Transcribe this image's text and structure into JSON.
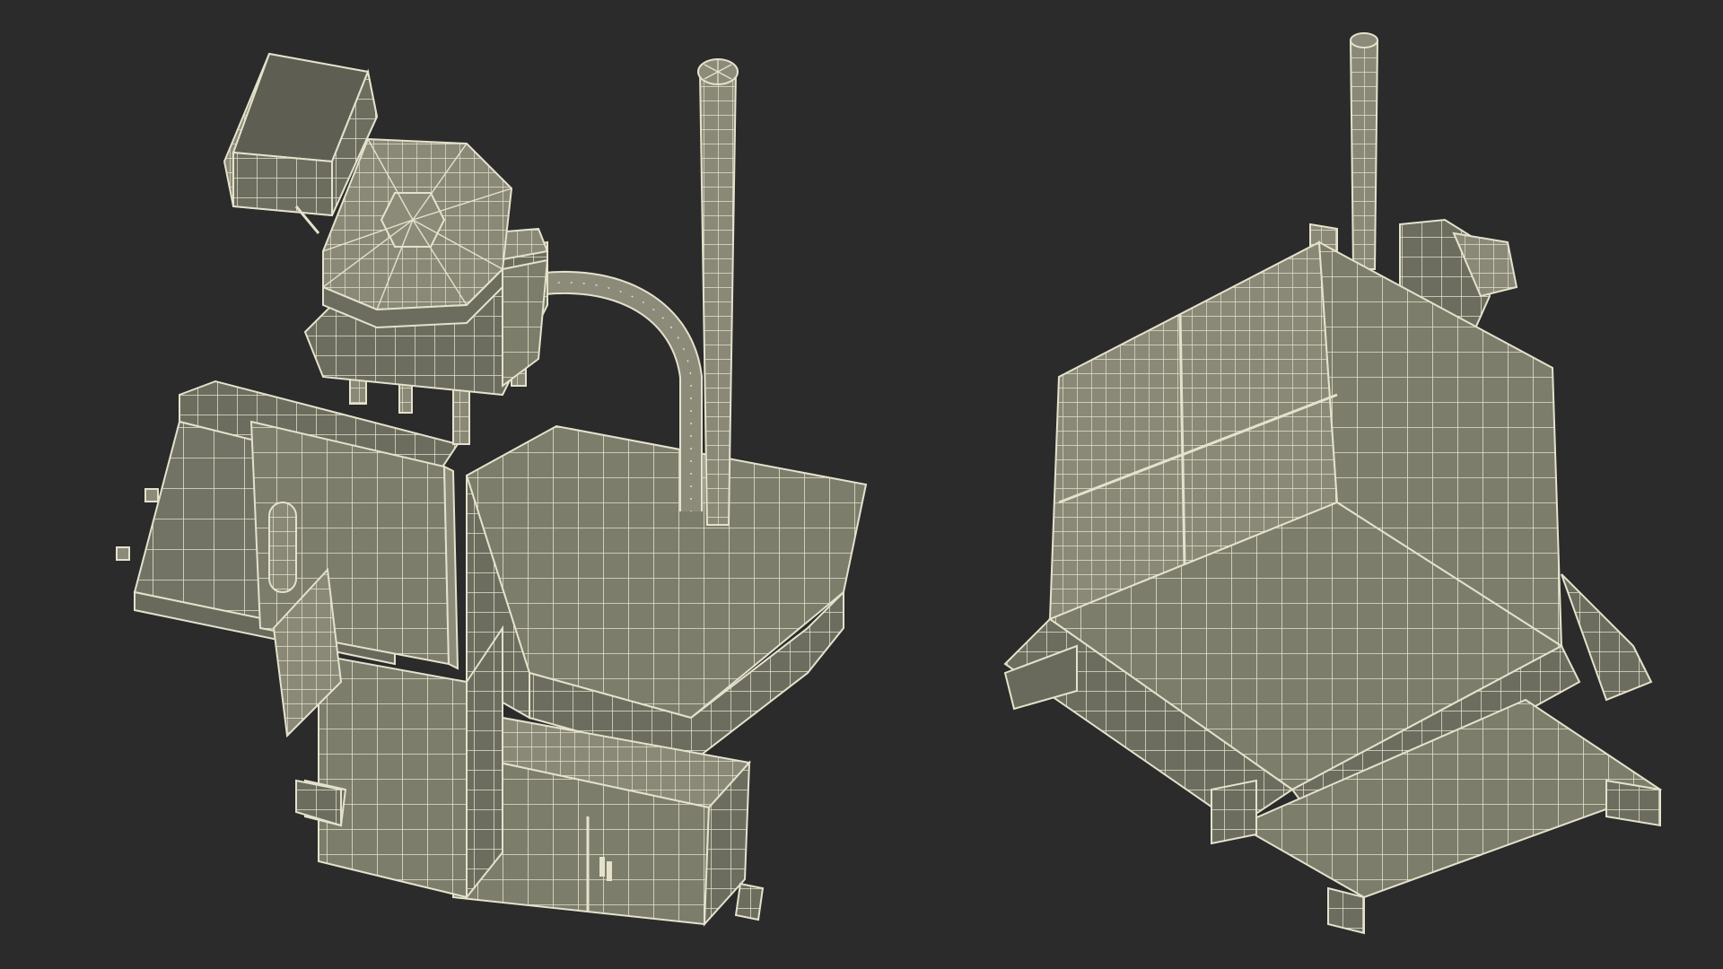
{
  "scene": {
    "background": "#2b2b2b",
    "wire_color": "#e4e2cc",
    "face_dark": "#6a6a5c",
    "face_mid": "#7d7d6c",
    "face_light": "#8c8b79",
    "views": [
      {
        "view": "top-perspective"
      },
      {
        "view": "bottom-perspective"
      }
    ]
  }
}
